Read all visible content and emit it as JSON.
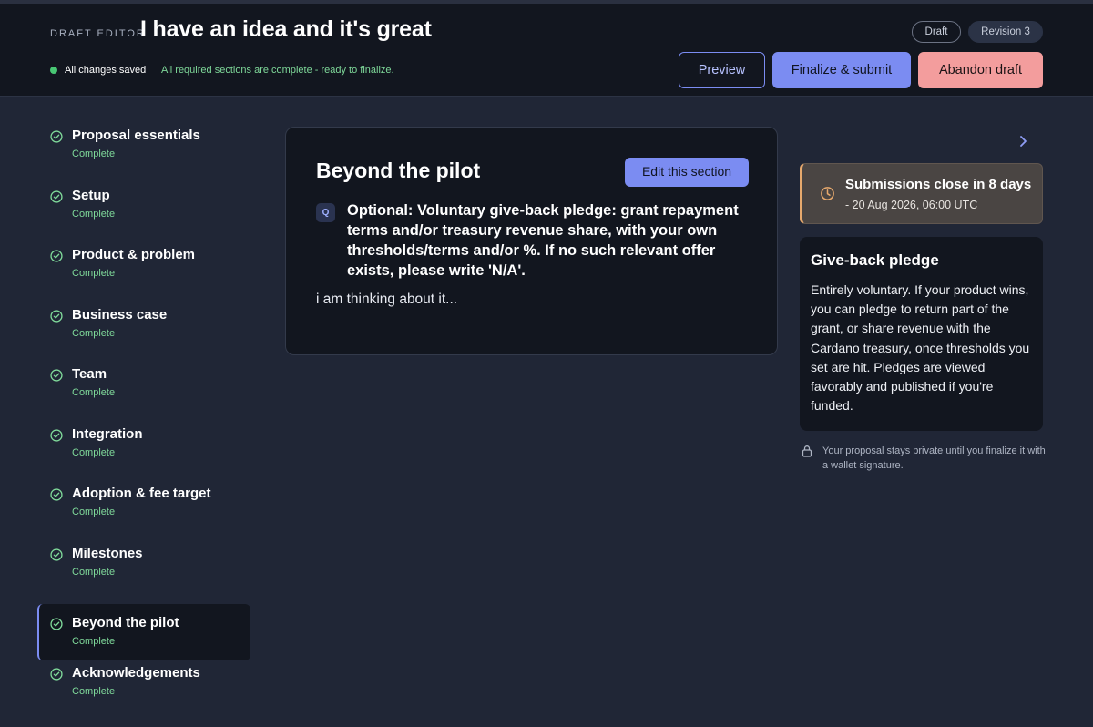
{
  "header": {
    "eyebrow": "DRAFT EDITOR",
    "title": "I have an idea and it's great",
    "chips": {
      "status": "Draft",
      "revision": "Revision 3"
    },
    "saved_status": "All changes saved",
    "completion_message": "All required sections are complete - ready to finalize.",
    "buttons": {
      "preview": "Preview",
      "finalize": "Finalize & submit",
      "abandon": "Abandon draft"
    }
  },
  "sidebar": {
    "items": [
      {
        "label": "Proposal essentials",
        "status": "Complete"
      },
      {
        "label": "Setup",
        "status": "Complete"
      },
      {
        "label": "Product & problem",
        "status": "Complete"
      },
      {
        "label": "Business case",
        "status": "Complete"
      },
      {
        "label": "Team",
        "status": "Complete"
      },
      {
        "label": "Integration",
        "status": "Complete"
      },
      {
        "label": "Adoption & fee target",
        "status": "Complete"
      },
      {
        "label": "Milestones",
        "status": "Complete"
      },
      {
        "label": "Beyond the pilot",
        "status": "Complete",
        "active": true
      },
      {
        "label": "Acknowledgements",
        "status": "Complete"
      }
    ]
  },
  "main": {
    "section_title": "Beyond the pilot",
    "edit_label": "Edit this section",
    "question_badge": "Q",
    "question": "Optional: Voluntary give-back pledge: grant repayment terms and/or treasury revenue share, with your own thresholds/terms and/or %. If no such relevant offer exists, please write 'N/A'.",
    "answer": "i am thinking about it..."
  },
  "rail": {
    "deadline_strong": "Submissions close in 8 days",
    "deadline_date": " - 20 Aug 2026, 06:00 UTC",
    "info_title": "Give-back pledge",
    "info_body": "Entirely voluntary. If your product wins, you can pledge to return part of the grant, or share revenue with the Cardano treasury, once thresholds you set are hit. Pledges are viewed favorably and published if you're funded.",
    "privacy_note": "Your proposal stays private until you finalize it with a wallet signature."
  },
  "colors": {
    "accent": "#7b8cf2",
    "success": "#7fd99a",
    "danger": "#f39d9d",
    "warning": "#e7a96d",
    "background": "#202636",
    "surface": "#12161f"
  },
  "icons": {
    "saved": "status-dot-icon",
    "section_complete": "check-circle-icon",
    "next": "chevron-right-icon",
    "deadline": "clock-icon",
    "privacy": "lock-icon"
  }
}
